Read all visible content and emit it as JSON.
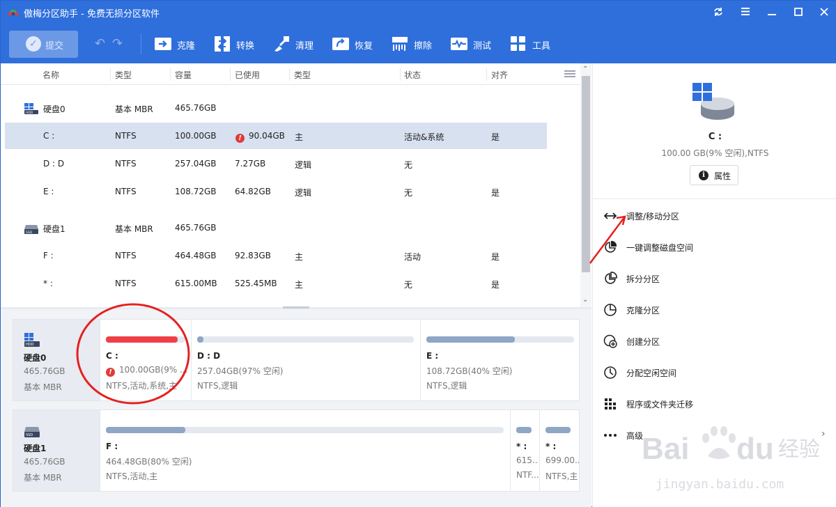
{
  "app": {
    "title": "傲梅分区助手 - 免费无损分区软件"
  },
  "window_controls": [
    "refresh-icon",
    "menu-icon",
    "minimize-icon",
    "maximize-icon",
    "close-icon"
  ],
  "toolbar": {
    "submit_label": "提交",
    "tools": [
      {
        "label": "克隆",
        "icon": "clone-icon"
      },
      {
        "label": "转换",
        "icon": "convert-icon"
      },
      {
        "label": "清理",
        "icon": "clean-icon"
      },
      {
        "label": "恢复",
        "icon": "recover-icon"
      },
      {
        "label": "擦除",
        "icon": "wipe-icon"
      },
      {
        "label": "测试",
        "icon": "test-icon"
      },
      {
        "label": "工具",
        "icon": "tools-icon"
      }
    ]
  },
  "columns": [
    "名称",
    "类型",
    "容量",
    "已使用",
    "类型",
    "状态",
    "对齐"
  ],
  "rows": [
    {
      "name": "硬盘0",
      "fs": "基本 MBR",
      "cap": "465.76GB",
      "used": "",
      "ptype": "",
      "status": "",
      "align": "",
      "disk": true,
      "disk_label": "HDD"
    },
    {
      "name": "C :",
      "fs": "NTFS",
      "cap": "100.00GB",
      "used": "90.04GB",
      "ptype": "主",
      "status": "活动&系统",
      "align": "是",
      "selected": true,
      "warn": true
    },
    {
      "name": "D : D",
      "fs": "NTFS",
      "cap": "257.04GB",
      "used": "7.27GB",
      "ptype": "逻辑",
      "status": "无",
      "align": ""
    },
    {
      "name": "E :",
      "fs": "NTFS",
      "cap": "108.72GB",
      "used": "64.82GB",
      "ptype": "逻辑",
      "status": "无",
      "align": "是"
    },
    {
      "name": "硬盘1",
      "fs": "基本 MBR",
      "cap": "465.76GB",
      "used": "",
      "ptype": "",
      "status": "",
      "align": "",
      "disk": true,
      "disk_label": "SSD"
    },
    {
      "name": "F :",
      "fs": "NTFS",
      "cap": "464.48GB",
      "used": "92.83GB",
      "ptype": "主",
      "status": "活动",
      "align": "是"
    },
    {
      "name": "* :",
      "fs": "NTFS",
      "cap": "615.00MB",
      "used": "525.45MB",
      "ptype": "主",
      "status": "无",
      "align": "是"
    }
  ],
  "disks": [
    {
      "name": "硬盘0",
      "size": "465.76GB",
      "type": "基本 MBR",
      "label": "HDD",
      "parts": [
        {
          "name": "C :",
          "line2": "100.00GB(9% ...",
          "line3": "NTFS,活动,系统,主",
          "used": 0.9,
          "color": "#ef3f46",
          "warn": true
        },
        {
          "name": "D : D",
          "line2": "257.04GB(97% 空闲)",
          "line3": "NTFS,逻辑",
          "used": 0.03,
          "color": "#8fa6c4"
        },
        {
          "name": "E :",
          "line2": "108.72GB(40% 空闲)",
          "line3": "NTFS,逻辑",
          "used": 0.6,
          "color": "#8fa6c4"
        }
      ]
    },
    {
      "name": "硬盘1",
      "size": "465.76GB",
      "type": "基本 MBR",
      "label": "SSD",
      "parts": [
        {
          "name": "F :",
          "line2": "464.48GB(80% 空闲)",
          "line3": "NTFS,活动,主",
          "used": 0.2,
          "color": "#8fa6c4"
        },
        {
          "name": "* :",
          "line2": "615...",
          "line3": "NTF...",
          "used": 1.0,
          "color": "#8fa6c4"
        },
        {
          "name": "* :",
          "line2": "699.00...",
          "line3": "NTFS,主",
          "used": 1.0,
          "color": "#8fa6c4"
        }
      ]
    }
  ],
  "right_panel": {
    "name": "C :",
    "info": "100.00 GB(9% 空闲),NTFS",
    "props_label": "属性",
    "ops": [
      {
        "label": "调整/移动分区",
        "icon": "resize-move-icon"
      },
      {
        "label": "一键调整磁盘空间",
        "icon": "pie-adjust-icon"
      },
      {
        "label": "拆分分区",
        "icon": "split-icon"
      },
      {
        "label": "克隆分区",
        "icon": "clone-partition-icon"
      },
      {
        "label": "创建分区",
        "icon": "create-partition-icon"
      },
      {
        "label": "分配空闲空间",
        "icon": "allocate-space-icon"
      },
      {
        "label": "程序或文件夹迁移",
        "icon": "app-mover-icon"
      },
      {
        "label": "高级",
        "icon": "more-icon"
      }
    ]
  },
  "watermark": {
    "brand": "Bai",
    "brand2": "du",
    "cn": "经验",
    "url": "jingyan.baidu.com"
  }
}
